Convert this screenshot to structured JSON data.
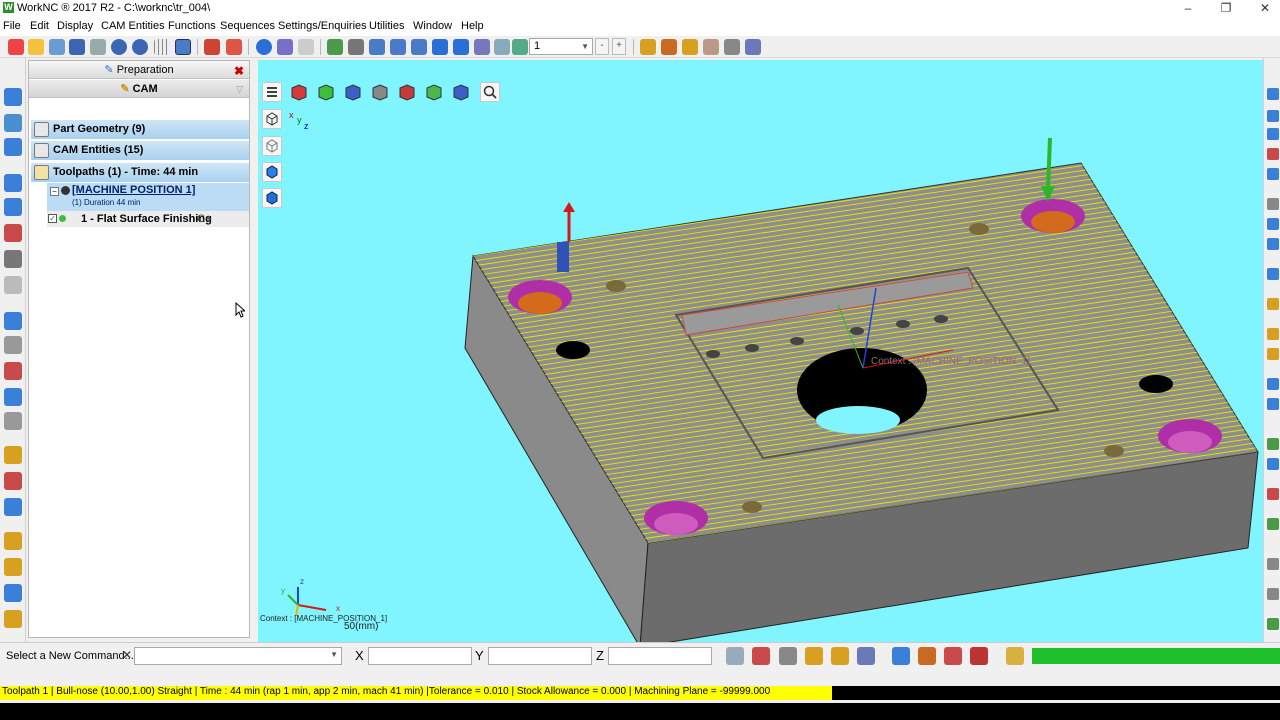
{
  "window": {
    "title": "WorkNC ® 2017 R2 - C:\\worknc\\tr_004\\",
    "minimize": "–",
    "maximize": "❐",
    "close": "✕"
  },
  "menu": [
    "File",
    "Edit",
    "Display",
    "CAM Entities",
    "Functions",
    "Sequences",
    "Settings/Enquiries",
    "Utilities",
    "Window",
    "Help"
  ],
  "toolbar": {
    "zoom_value": "1",
    "step_down": "-",
    "step_up": "+"
  },
  "panel": {
    "header": "Preparation",
    "close": "✖",
    "tab": "CAM",
    "groups": [
      {
        "label": "Part Geometry (9)"
      },
      {
        "label": "CAM Entities (15)"
      },
      {
        "label": "Toolpaths (1) - Time: 44 min"
      }
    ],
    "node": {
      "name": "[MACHINE POSITION 1]",
      "detail": "(1) Duration 44 min"
    },
    "item": {
      "label": "1 - Flat Surface Finishing",
      "suffix": "C+"
    }
  },
  "viewport": {
    "context": "Context : [MACHINE_POSITION_1]",
    "scale": "50(mm)",
    "in_scene_context": "Context : [MACHINE_POSITION_1]",
    "axis_x": "x",
    "axis_y": "y",
    "axis_z": "z"
  },
  "cmdbar": {
    "label": "Select a New Command...",
    "close": "✕",
    "x_label": "X",
    "y_label": "Y",
    "z_label": "Z"
  },
  "status": {
    "text": "Toolpath 1 | Bull-nose (10.00,1.00) Straight | Time : 44 min (rap 1 min, app 2 min, mach 41 min) |Tolerance = 0.010 | Stock Allowance = 0.000 | Machining Plane = -99999.000"
  },
  "colors": {
    "viewport_bg": "#80f5ff",
    "toolpath": "#e6e600",
    "progress": "#1fbf2a",
    "group_highlight": "#a9d0ee"
  },
  "icons": [
    "new-icon",
    "open-icon",
    "save-icon",
    "undo-icon",
    "redo-icon",
    "grid-icon",
    "view-icon",
    "zoom-icon",
    "rotate-icon",
    "pan-icon",
    "fit-icon"
  ]
}
